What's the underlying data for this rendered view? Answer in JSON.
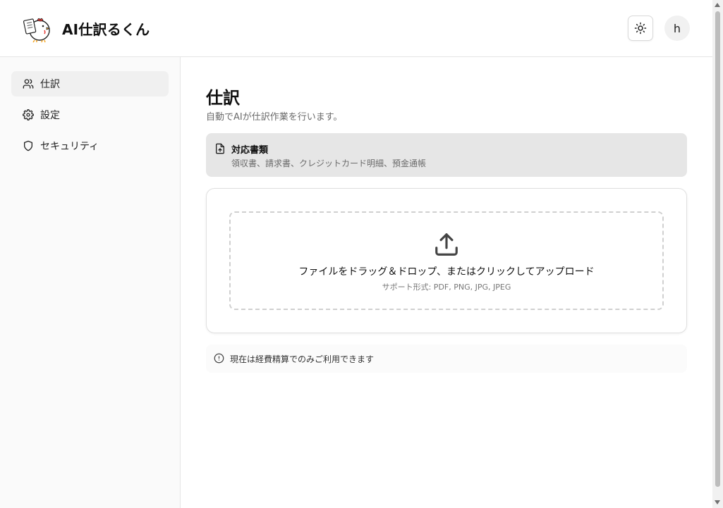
{
  "app": {
    "title": "AI仕訳るくん",
    "logo_icon": "chicken-mascot-icon"
  },
  "header": {
    "theme_icon": "sun-icon",
    "avatar_initial": "h"
  },
  "sidebar": {
    "items": [
      {
        "label": "仕訳",
        "icon": "users-icon",
        "active": true
      },
      {
        "label": "設定",
        "icon": "gear-icon",
        "active": false
      },
      {
        "label": "セキュリティ",
        "icon": "shield-icon",
        "active": false
      }
    ]
  },
  "main": {
    "title": "仕訳",
    "subtitle": "自動でAIが仕訳作業を行います。",
    "supported": {
      "title": "対応書類",
      "description": "領収書、請求書、クレジットカード明細、預金通帳"
    },
    "upload": {
      "prompt": "ファイルをドラッグ＆ドロップ、またはクリックしてアップロード",
      "support": "サポート形式: PDF, PNG, JPG, JPEG"
    },
    "notice": "現在は経費精算でのみご利用できます"
  },
  "colors": {
    "accent": "#111111",
    "muted_text": "#6b6b6b",
    "sidebar_bg": "#fafafa",
    "info_bg": "#e6e6e6"
  }
}
